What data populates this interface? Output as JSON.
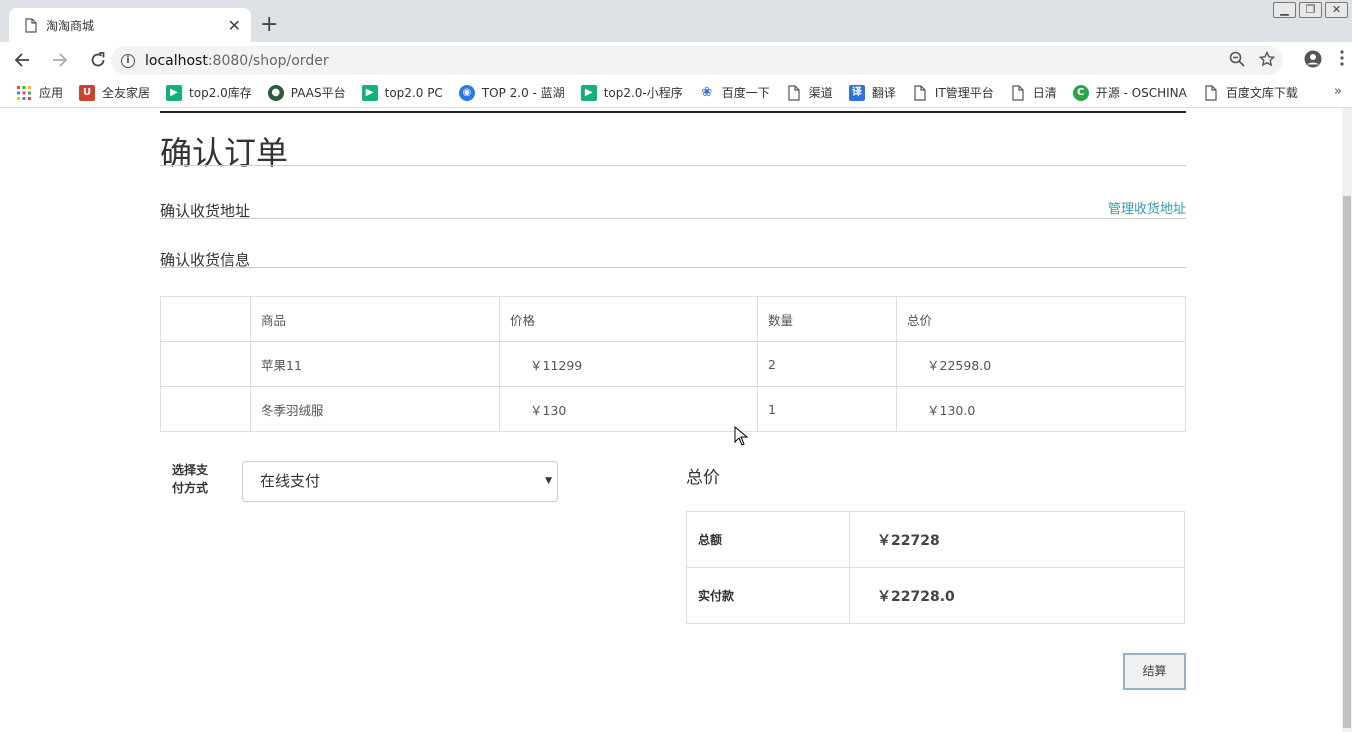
{
  "browser": {
    "tab_title": "淘淘商城",
    "new_tab_symbol": "+",
    "url_host": "localhost",
    "url_rest": ":8080/shop/order",
    "bookmarks": [
      {
        "label": "应用",
        "icon": "apps-grid-icon"
      },
      {
        "label": "全友家居",
        "icon": "quanyou-icon"
      },
      {
        "label": "top2.0库存",
        "icon": "play-green-icon"
      },
      {
        "label": "PAAS平台",
        "icon": "paas-icon"
      },
      {
        "label": "top2.0 PC",
        "icon": "play-green-icon"
      },
      {
        "label": "TOP 2.0 - 蓝湖",
        "icon": "lanhu-icon"
      },
      {
        "label": "top2.0-小程序",
        "icon": "play-green-icon"
      },
      {
        "label": "百度一下",
        "icon": "baidu-paw-icon"
      },
      {
        "label": "渠道",
        "icon": "page-icon"
      },
      {
        "label": "翻译",
        "icon": "translate-icon"
      },
      {
        "label": "IT管理平台",
        "icon": "page-icon"
      },
      {
        "label": "日清",
        "icon": "page-icon"
      },
      {
        "label": "开源 - OSCHINA",
        "icon": "oschina-icon"
      },
      {
        "label": "百度文库下载",
        "icon": "page-icon"
      }
    ],
    "more_symbol": "»"
  },
  "page": {
    "title": "确认订单",
    "address_section": "确认收货地址",
    "manage_address_link": "管理收货地址",
    "info_section": "确认收货信息",
    "table": {
      "headers": [
        "",
        "商品",
        "价格",
        "数量",
        "总价"
      ],
      "rows": [
        {
          "name": "苹果11",
          "price": "￥11299",
          "qty": "2",
          "total": "￥22598.0"
        },
        {
          "name": "冬季羽绒服",
          "price": "￥130",
          "qty": "1",
          "total": "￥130.0"
        }
      ]
    },
    "payment": {
      "label": "选择支付方式",
      "selected": "在线支付"
    },
    "summary": {
      "title": "总价",
      "rows": [
        {
          "label": "总额",
          "value": "￥22728"
        },
        {
          "label": "实付款",
          "value": "￥22728.0"
        }
      ]
    },
    "checkout_button": "结算"
  }
}
